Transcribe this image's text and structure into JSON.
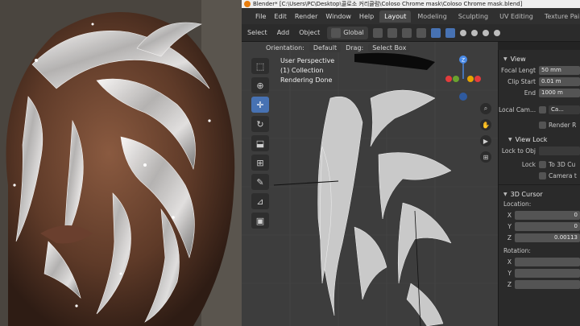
{
  "titlebar": {
    "text": "Blender* [C:\\Users\\PC\\Desktop\\콜로소 커리큘럼\\Coloso Chrome mask\\Coloso Chrome mask.blend]"
  },
  "menubar": {
    "menus": [
      "File",
      "Edit",
      "Render",
      "Window",
      "Help"
    ],
    "workspaces": [
      "Layout",
      "Modeling",
      "Sculpting",
      "UV Editing",
      "Texture Paint"
    ],
    "active_workspace": "Layout"
  },
  "toolbar": {
    "select": "Select",
    "add": "Add",
    "object": "Object",
    "transform_orientation": "Global",
    "orientation_label": "Orientation:",
    "orientation_value": "Default",
    "drag_label": "Drag:",
    "drag_value": "Select Box"
  },
  "viewport": {
    "line1": "User Perspective",
    "line2": "(1) Collection",
    "line3": "Rendering Done",
    "gizmo_axis": "Z"
  },
  "npanel": {
    "view_header": "View",
    "focal_label": "Focal Lengt",
    "focal_value": "50 mm",
    "clip_start_label": "Clip Start",
    "clip_start_value": "0.01 m",
    "end_label": "End",
    "end_value": "1000 m",
    "local_cam_label": "Local Cam...",
    "local_cam_value": "Ca...",
    "render_region_label": "Render R",
    "view_lock_header": "View Lock",
    "lock_to_obj_label": "Lock to Obj",
    "lock_label": "Lock",
    "to_3d_cursor_label": "To 3D Cu",
    "camera_label": "Camera t",
    "cursor_header": "3D Cursor",
    "location_label": "Location:",
    "x_label": "X",
    "x_value": "0",
    "y_label": "Y",
    "y_value": "0",
    "z_label": "Z",
    "z_value": "0.00113",
    "rotation_label": "Rotation:",
    "rx_label": "X",
    "ry_label": "Y",
    "rz_label": "Z"
  },
  "colors": {
    "blender_orange": "#e87d0d",
    "active_blue": "#4772b3",
    "viewport_bg": "#3d3d3d"
  }
}
